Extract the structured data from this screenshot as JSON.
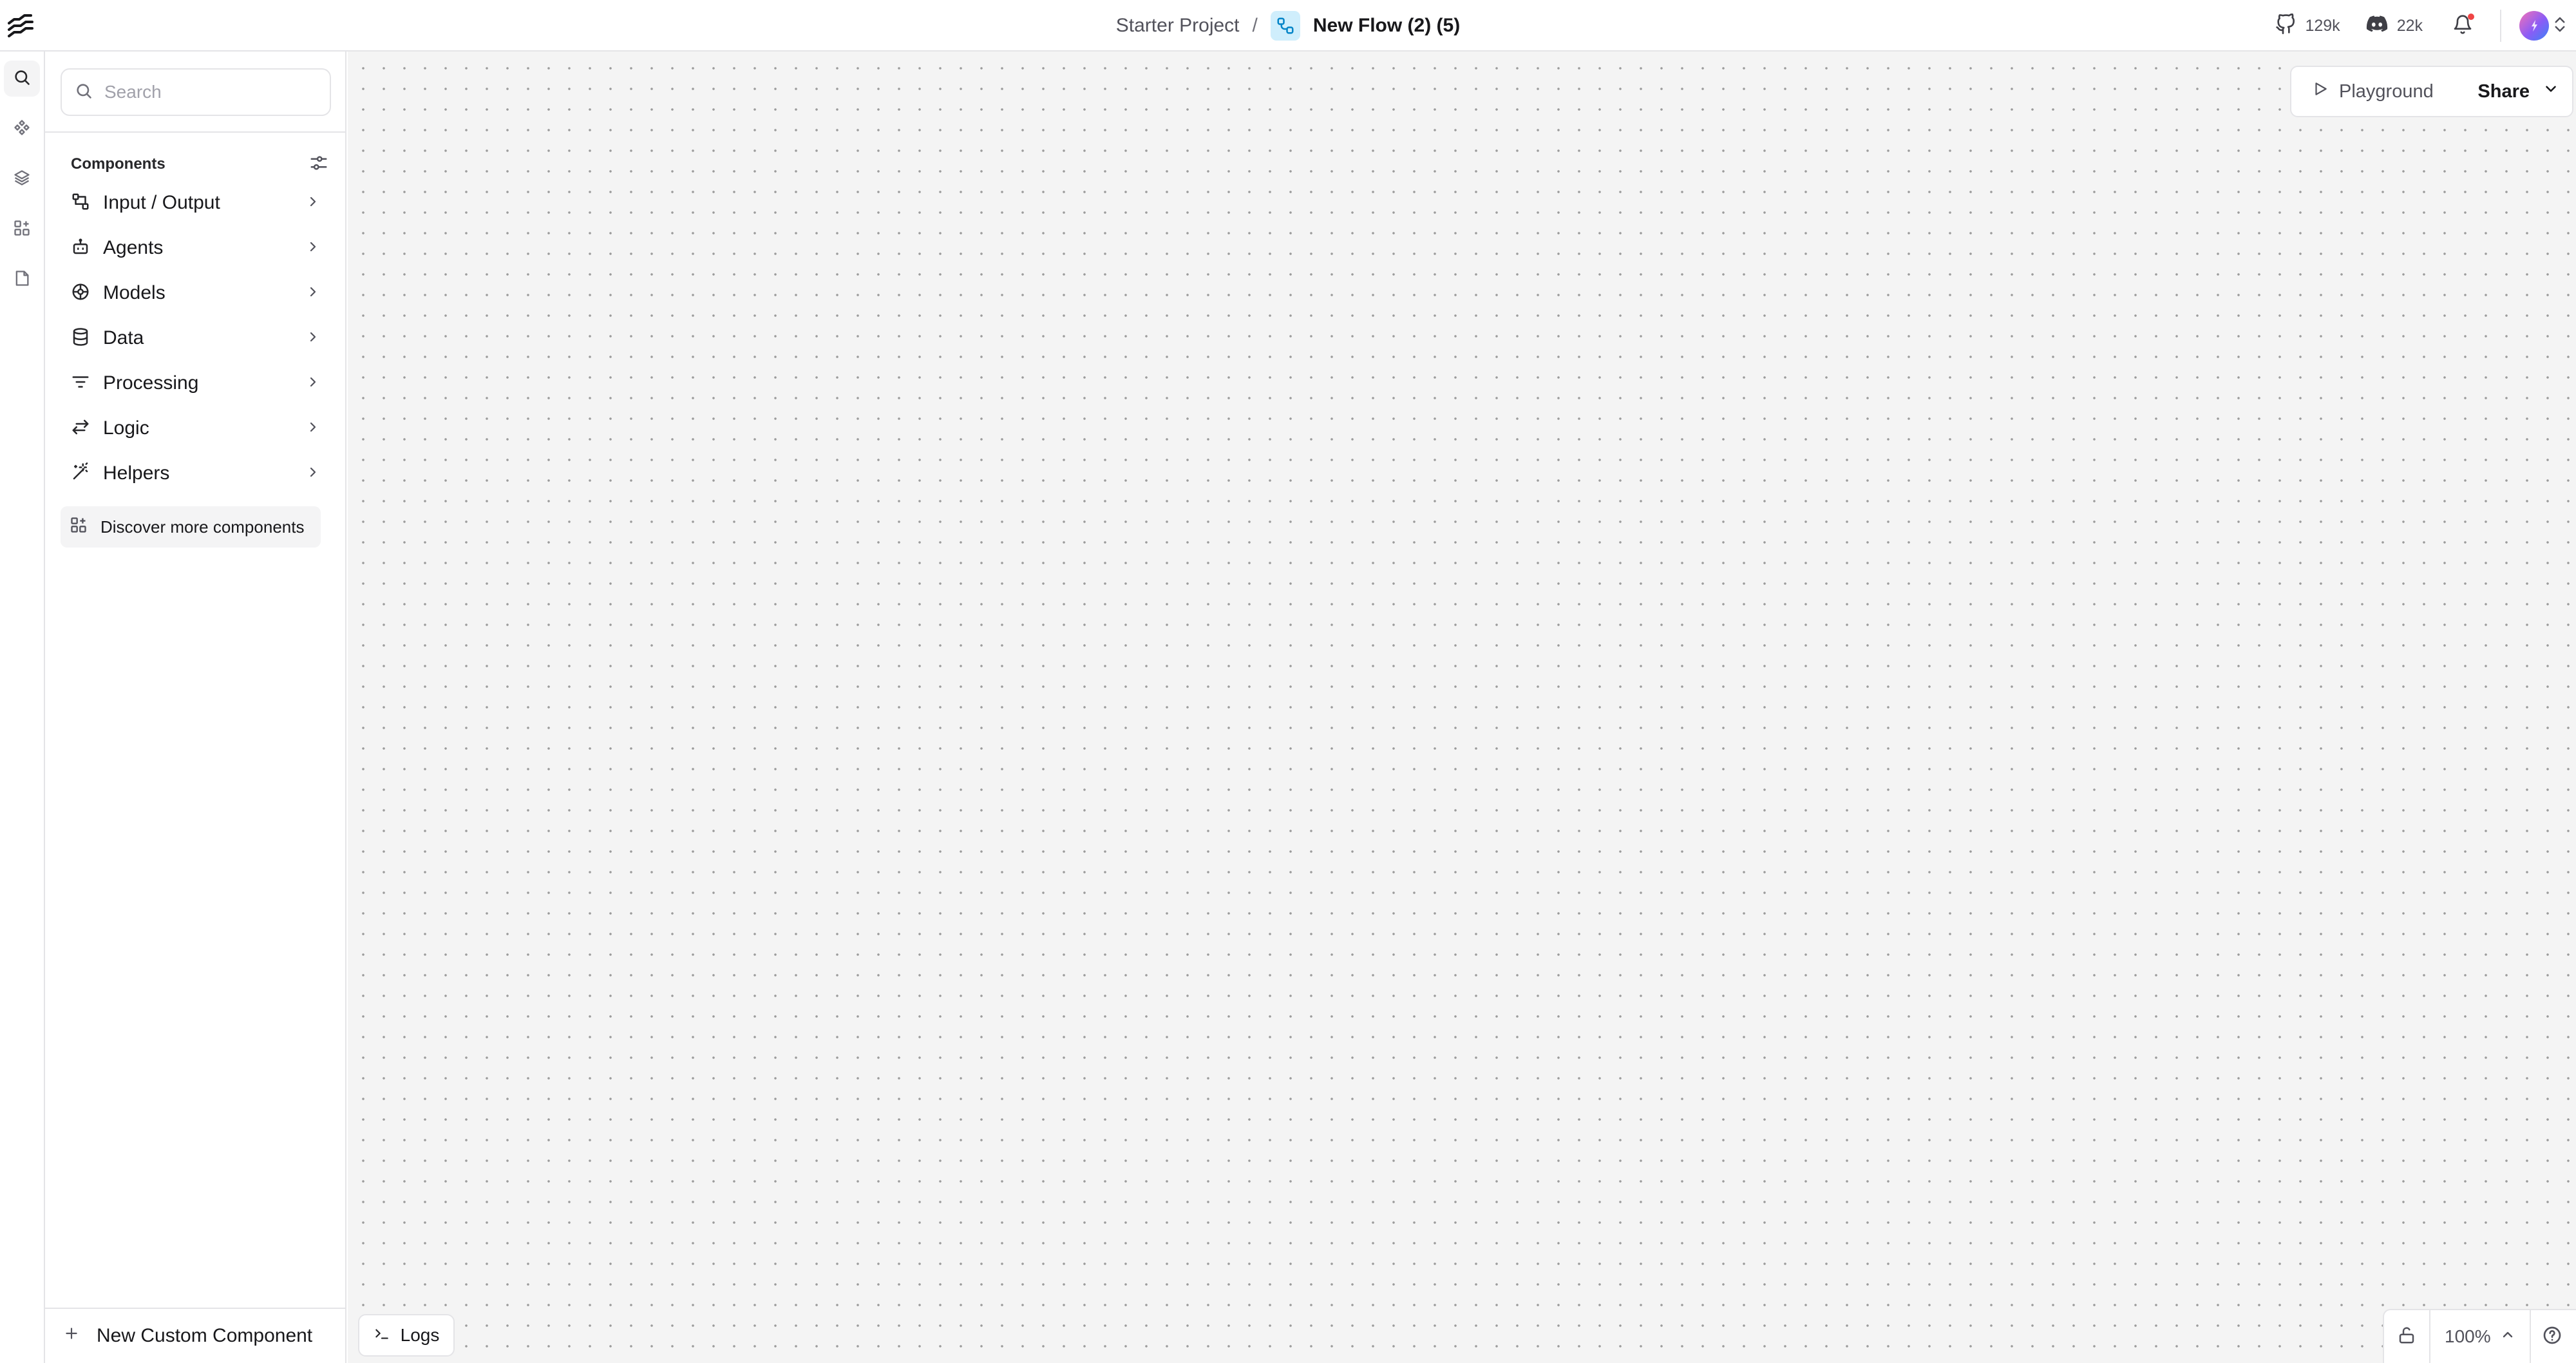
{
  "header": {
    "project": "Starter Project",
    "separator": "/",
    "flow_name": "New Flow (2) (5)",
    "github_stars": "129k",
    "discord_members": "22k"
  },
  "rail": {
    "items": [
      "search-icon",
      "components-icon",
      "bundles-icon",
      "store-icon",
      "document-icon"
    ]
  },
  "sidebar": {
    "search_placeholder": "Search",
    "search_shortcut": "/",
    "section_title": "Components",
    "categories": [
      {
        "label": "Input / Output",
        "icon": "input-output-icon"
      },
      {
        "label": "Agents",
        "icon": "bot-icon"
      },
      {
        "label": "Models",
        "icon": "brain-icon"
      },
      {
        "label": "Data",
        "icon": "database-icon"
      },
      {
        "label": "Processing",
        "icon": "list-filter-icon"
      },
      {
        "label": "Logic",
        "icon": "arrow-left-right-icon"
      },
      {
        "label": "Helpers",
        "icon": "wand-icon"
      }
    ],
    "discover_label": "Discover more components",
    "new_component_label": "New Custom Component"
  },
  "canvas": {
    "playground_label": "Playground",
    "share_label": "Share",
    "logs_label": "Logs",
    "zoom_level": "100%"
  },
  "colors": {
    "accent": "#18181b",
    "muted": "#71717a",
    "border": "#e4e4e7",
    "flow_icon_bg": "#cfeefc",
    "notification_dot": "#ef4444",
    "canvas_bg": "#f4f4f4"
  }
}
